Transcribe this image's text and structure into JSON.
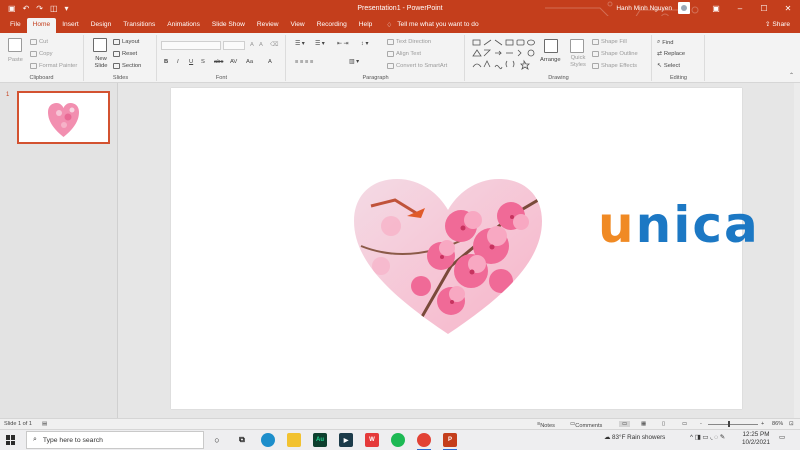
{
  "window": {
    "title": "Presentation1  -  PowerPoint",
    "user_name": "Hanh Minh Nguyen",
    "share_label": "Share"
  },
  "menu": {
    "tabs": [
      "File",
      "Home",
      "Insert",
      "Design",
      "Transitions",
      "Animations",
      "Slide Show",
      "Review",
      "View",
      "Recording",
      "Help"
    ],
    "active_tab": "Home",
    "tell_me": "Tell me what you want to do"
  },
  "ribbon": {
    "clipboard": {
      "label": "Clipboard",
      "paste": "Paste",
      "cut": "Cut",
      "copy": "Copy",
      "format_painter": "Format Painter"
    },
    "slides": {
      "label": "Slides",
      "new_slide": "New Slide",
      "layout": "Layout",
      "reset": "Reset",
      "section": "Section"
    },
    "font": {
      "label": "Font",
      "bold": "B",
      "italic": "I",
      "underline": "U",
      "strike": "S",
      "shadow": "abc",
      "spacing": "AV",
      "case": "Aa",
      "grow": "A",
      "shrink": "A"
    },
    "paragraph": {
      "label": "Paragraph",
      "text_direction": "Text Direction",
      "align_text": "Align Text",
      "convert_smartart": "Convert to SmartArt"
    },
    "drawing": {
      "label": "Drawing",
      "arrange": "Arrange",
      "quick_styles": "Quick Styles",
      "shape_fill": "Shape Fill",
      "shape_outline": "Shape Outline",
      "shape_effects": "Shape Effects"
    },
    "editing": {
      "label": "Editing",
      "find": "Find",
      "replace": "Replace",
      "select": "Select"
    }
  },
  "slides_panel": {
    "number": "1"
  },
  "slide": {
    "logo_u": "u",
    "logo_rest": "nica"
  },
  "status": {
    "slide_info": "Slide 1 of 1",
    "notes": "Notes",
    "comments": "Comments",
    "zoom_minus": "-",
    "zoom_plus": "+",
    "zoom": "86%"
  },
  "taskbar": {
    "search_placeholder": "Type here to search",
    "weather": "83°F  Rain showers",
    "time": "12:25 PM",
    "date": "10/2/2021",
    "apps": [
      "cortana",
      "task-view",
      "edge",
      "file-explorer",
      "audition",
      "media",
      "wps",
      "spotify",
      "chrome",
      "powerpoint"
    ]
  },
  "colors": {
    "accent": "#c43e1c",
    "unica_orange": "#f08a24",
    "unica_blue": "#1c78c4",
    "blossom": "#f06a97"
  }
}
